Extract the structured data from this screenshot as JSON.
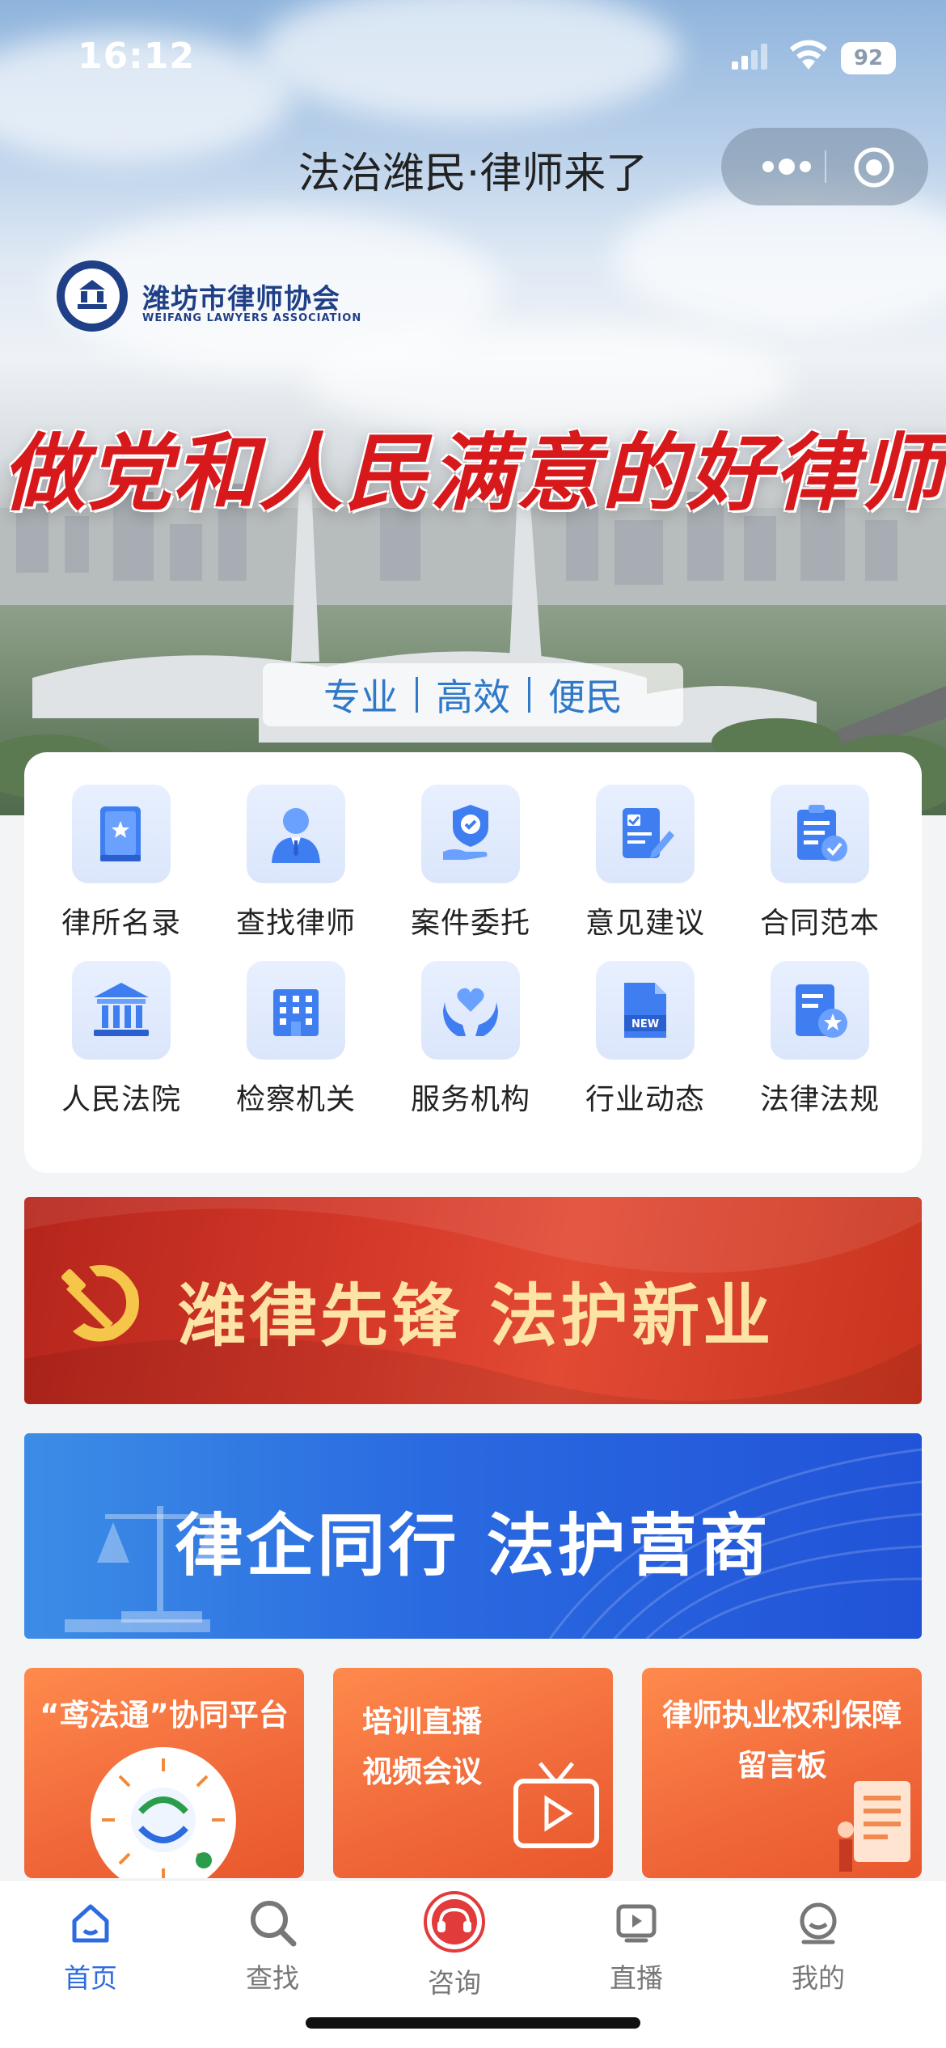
{
  "status_bar": {
    "time": "16:12",
    "battery": "92"
  },
  "nav": {
    "title": "法治潍民·律师来了"
  },
  "hero": {
    "logo_name": "潍坊市律师协会",
    "logo_sub": "WEIFANG LAWYERS ASSOCIATION",
    "slogan": "做党和人民满意的好律师",
    "tags": [
      "专业",
      "高效",
      "便民"
    ]
  },
  "services": [
    {
      "label": "律所名录",
      "icon": "book-star-icon"
    },
    {
      "label": "查找律师",
      "icon": "lawyer-person-icon"
    },
    {
      "label": "案件委托",
      "icon": "shield-hand-icon"
    },
    {
      "label": "意见建议",
      "icon": "edit-document-icon"
    },
    {
      "label": "合同范本",
      "icon": "contract-check-icon"
    },
    {
      "label": "人民法院",
      "icon": "courthouse-icon"
    },
    {
      "label": "检察机关",
      "icon": "office-building-icon"
    },
    {
      "label": "服务机构",
      "icon": "heart-hands-icon"
    },
    {
      "label": "行业动态",
      "icon": "news-new-icon"
    },
    {
      "label": "法律法规",
      "icon": "regulation-star-icon"
    }
  ],
  "banners": {
    "red": "潍律先锋  法护新业",
    "blue": "律企同行  法护营商"
  },
  "tiles": [
    {
      "title": "“鸢法通”协同平台",
      "sub": ""
    },
    {
      "title": "培训直播",
      "sub": "视频会议"
    },
    {
      "title": "律师执业权利保障",
      "sub": "留言板"
    }
  ],
  "tabs": [
    {
      "label": "首页",
      "icon": "home-icon",
      "active": true
    },
    {
      "label": "查找",
      "icon": "search-icon"
    },
    {
      "label": "咨询",
      "icon": "consult-icon"
    },
    {
      "label": "直播",
      "icon": "live-play-icon"
    },
    {
      "label": "我的",
      "icon": "profile-icon"
    }
  ],
  "colors": {
    "accent": "#2d6be0",
    "slogan_red": "#d7191c",
    "tile_orange": "#f0683a"
  }
}
